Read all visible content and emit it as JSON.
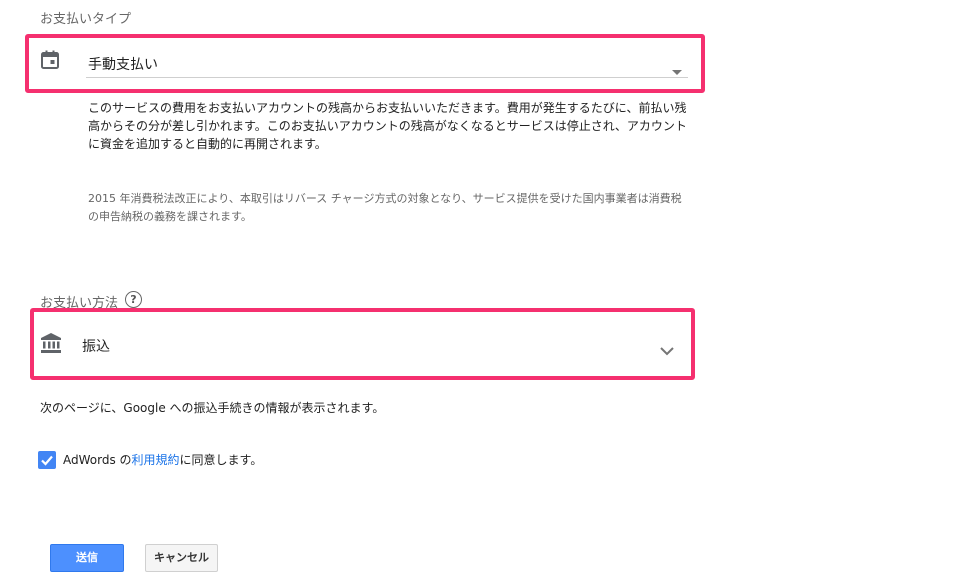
{
  "payment_type": {
    "label": "お支払いタイプ",
    "icon": "calendar-icon",
    "selected_value": "手動支払い",
    "description": "このサービスの費用をお支払いアカウントの残高からお支払いいただきます。費用が発生するたびに、前払い残高からその分が差し引かれます。このお支払いアカウントの残高がなくなるとサービスは停止され、アカウントに資金を追加すると自動的に再開されます。",
    "tax_note": "2015 年消費税法改正により、本取引はリバース チャージ方式の対象となり、サービス提供を受けた国内事業者は消費税の申告納税の義務を課されます。"
  },
  "payment_method": {
    "label": "お支払い方法",
    "help_icon": "help-circle-icon",
    "help_glyph": "?",
    "icon": "bank-icon",
    "selected_value": "振込",
    "info": "次のページに、Google への振込手続きの情報が表示されます。"
  },
  "terms": {
    "checked": true,
    "prefix": "AdWords の",
    "link_text": "利用規約",
    "suffix": "に同意します。"
  },
  "buttons": {
    "submit": "送信",
    "cancel": "キャンセル"
  },
  "colors": {
    "highlight": "#f5306f",
    "primary": "#4d90fe",
    "link": "#1a73e8",
    "checkbox": "#4285f4"
  }
}
